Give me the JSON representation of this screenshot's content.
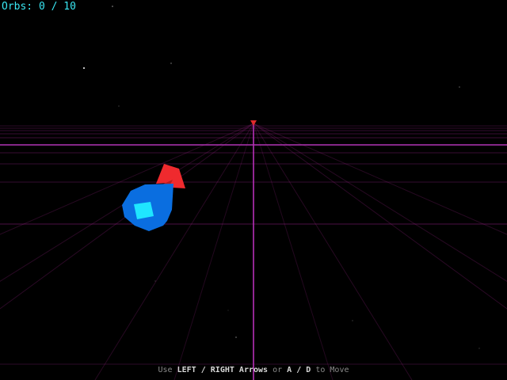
{
  "hud": {
    "score_label": "Orbs:",
    "orbs_collected": "0",
    "separator": "/",
    "orbs_total": "10"
  },
  "instructions": {
    "prefix": "Use",
    "key_left": "LEFT",
    "slash1": "/",
    "key_right": "RIGHT",
    "arrows": "Arrows",
    "or": "or",
    "key_a": "A",
    "slash2": "/",
    "key_d": "D",
    "suffix": "to Move"
  },
  "colors": {
    "background": "#000000",
    "grid": "#b1279c",
    "horizon": "#c43ac9",
    "hud_text": "#39e6f2",
    "ship_body": "#0a6ee0",
    "ship_cockpit": "#1fe6ff",
    "ship_fin": "#ef2a2e",
    "marker": "#e02a2a"
  },
  "icons": {
    "player": "player-ship-icon",
    "marker": "target-marker-icon"
  }
}
